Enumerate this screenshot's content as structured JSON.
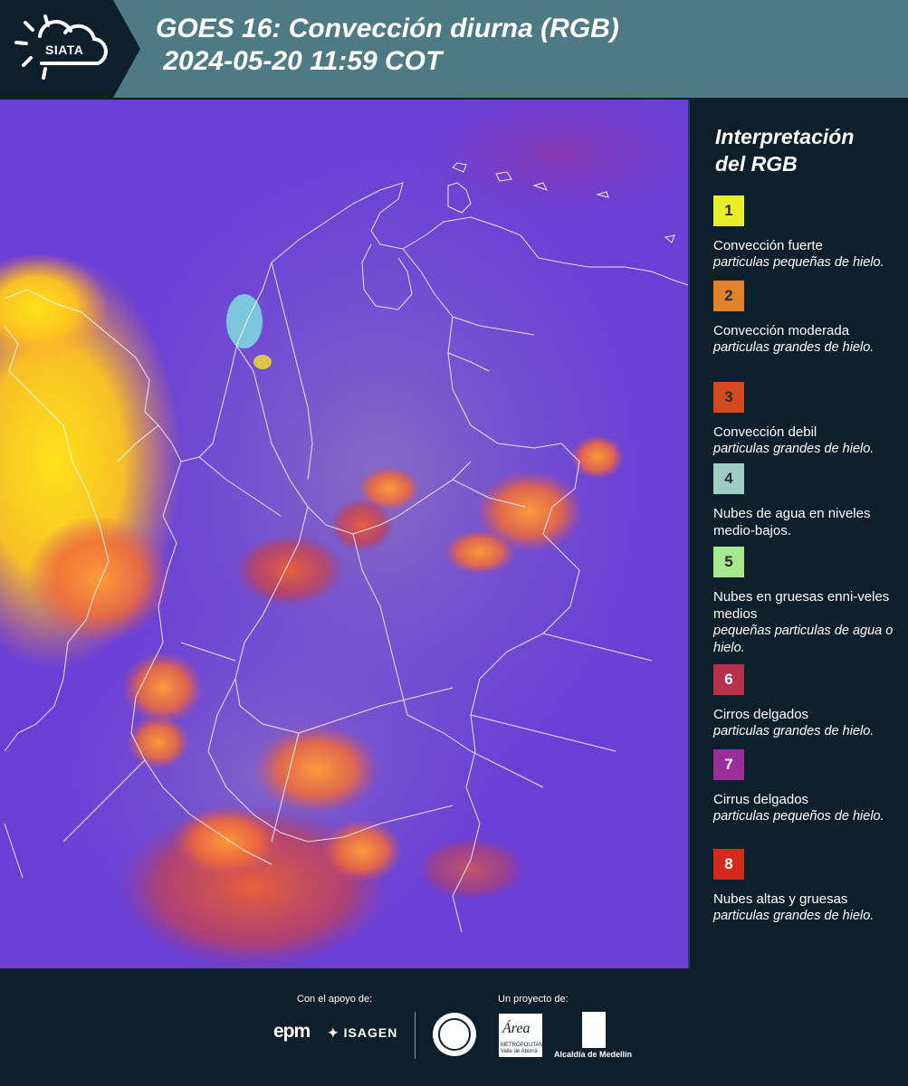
{
  "header": {
    "logo_text": "SIATA",
    "title_line1": "GOES 16: Convección diurna (RGB)",
    "title_line2": " 2024-05-20 11:59 COT",
    "bg_color": "#4e7a86"
  },
  "map": {
    "icon": "satellite-map",
    "base_color": "#6a3fd8"
  },
  "legend": {
    "title_line1": "Interpretación",
    "title_line2": "del RGB",
    "items": [
      {
        "number": "1",
        "color": "#e8ee2a",
        "label": "Convección fuerte",
        "desc": "particulas pequeñas de hielo."
      },
      {
        "number": "2",
        "color": "#e3822c",
        "label": "Convección moderada",
        "desc": "particulas grandes de hielo."
      },
      {
        "number": "3",
        "color": "#d44a1e",
        "label": "Convección debil",
        "desc": "particulas grandes de hielo."
      },
      {
        "number": "4",
        "color": "#9fcdc4",
        "label": "Nubes de agua en niveles medio-bajos.",
        "desc": ""
      },
      {
        "number": "5",
        "color": "#a6e88c",
        "label": "Nubes en gruesas enni-veles medios",
        "desc": "pequeñas particulas de agua o hielo."
      },
      {
        "number": "6",
        "color": "#b5314c",
        "label": "Cirros delgados",
        "desc": "particulas grandes de hielo."
      },
      {
        "number": "7",
        "color": "#9a2e9a",
        "label": "Cirrus delgados",
        "desc": "particulas pequeños de hielo."
      },
      {
        "number": "8",
        "color": "#d42a1c",
        "label": "Nubes altas y gruesas",
        "desc": "particulas grandes de hielo."
      }
    ]
  },
  "footer": {
    "support_label": "Con el apoyo de:",
    "project_label": "Un proyecto de:",
    "sponsor1": "epm",
    "sponsor2": "ISAGEN",
    "partner_area": "Área",
    "partner_area_sub": "METROPOLITANA Valle de Aburrá",
    "partner_alcaldia": "Alcaldía de Medellín"
  }
}
